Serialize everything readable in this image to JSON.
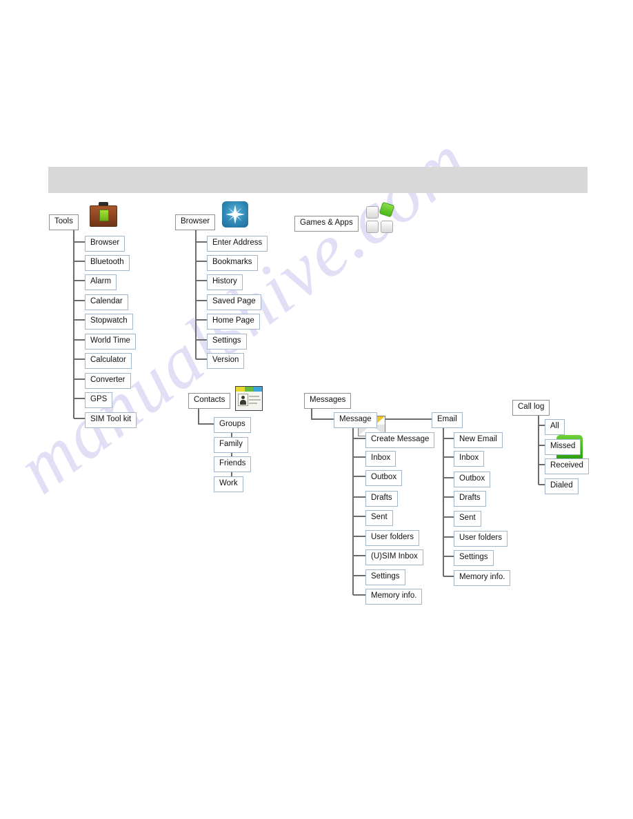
{
  "page": {
    "watermark": "manualshive.com",
    "header_band": ""
  },
  "trees": [
    {
      "id": "tools",
      "root": "Tools",
      "icon": "briefcase-icon",
      "children": [
        "Browser",
        "Bluetooth",
        "Alarm",
        "Calendar",
        "Stopwatch",
        "World Time",
        "Calculator",
        "Converter",
        "GPS",
        "SIM Tool kit"
      ]
    },
    {
      "id": "browser",
      "root": "Browser",
      "icon": "starburst-icon",
      "children": [
        "Enter Address",
        "Bookmarks",
        "History",
        "Saved Page",
        "Home Page",
        "Settings",
        "Version"
      ]
    },
    {
      "id": "games",
      "root": "Games & Apps",
      "icon": "tiles-icon",
      "children": []
    },
    {
      "id": "contacts",
      "root": "Contacts",
      "icon": "contact-card-icon",
      "group": "Groups",
      "children": [
        "Family",
        "Friends",
        "Work"
      ]
    },
    {
      "id": "messages",
      "root": "Messages",
      "icon": "envelope-icon",
      "branches": [
        {
          "label": "Message",
          "children": [
            "Create Message",
            "Inbox",
            "Outbox",
            "Drafts",
            "Sent",
            "User folders",
            "(U)SIM Inbox",
            "Settings",
            "Memory info."
          ]
        },
        {
          "label": "Email",
          "children": [
            "New Email",
            "Inbox",
            "Outbox",
            "Drafts",
            "Sent",
            "User folders",
            "Settings",
            "Memory info."
          ]
        }
      ]
    },
    {
      "id": "calllog",
      "root": "Call log",
      "icon": "phone-call-icon",
      "children": [
        "All",
        "Missed",
        "Received",
        "Dialed"
      ]
    }
  ],
  "colors": {
    "box_border": "#9fb6cc",
    "root_border": "#8e8e8e",
    "connector": "#6b6b6b",
    "header_band": "#d8d8d8",
    "watermark": "#c9c6ef"
  }
}
